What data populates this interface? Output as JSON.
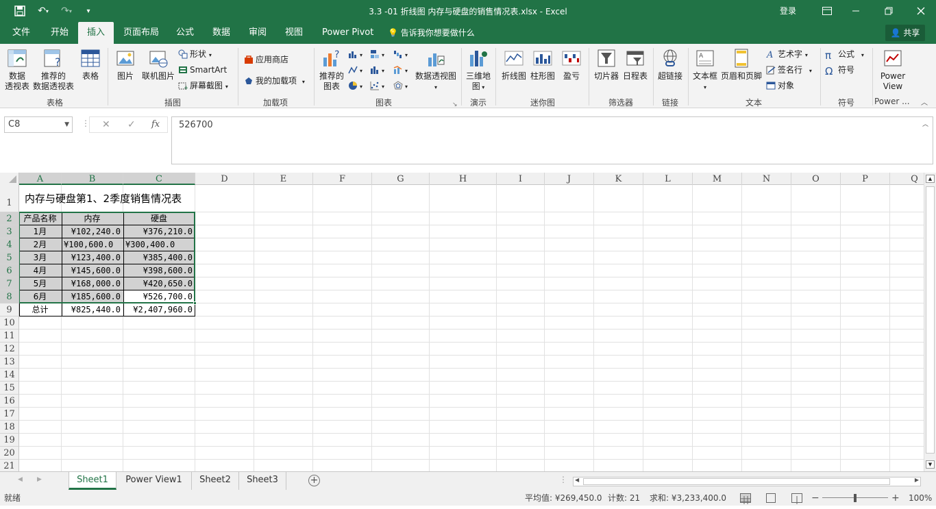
{
  "titlebar": {
    "doc_title": "3.3 -01 折线图 内存与硬盘的销售情况表.xlsx  -  Excel",
    "login": "登录"
  },
  "tabs": [
    {
      "label": "文件"
    },
    {
      "label": "开始"
    },
    {
      "label": "插入",
      "active": true
    },
    {
      "label": "页面布局"
    },
    {
      "label": "公式"
    },
    {
      "label": "数据"
    },
    {
      "label": "审阅"
    },
    {
      "label": "视图"
    },
    {
      "label": "Power Pivot"
    }
  ],
  "tellme": "告诉我你想要做什么",
  "share": "共享",
  "ribbon": {
    "groups": {
      "tables": "表格",
      "illustrations": "插图",
      "addins": "加载项",
      "charts": "图表",
      "tours": "演示",
      "sparklines": "迷你图",
      "filters": "筛选器",
      "links": "链接",
      "text": "文本",
      "symbols": "符号",
      "powerview": "Power ..."
    },
    "buttons": {
      "pivot1": "数据",
      "pivot2": "透视表",
      "recpivot1": "推荐的",
      "recpivot2": "数据透视表",
      "table": "表格",
      "picture": "图片",
      "online_picture": "联机图片",
      "shapes": "形状",
      "smartart": "SmartArt",
      "screenshot": "屏幕截图",
      "store": "应用商店",
      "my_addins": "我的加载项",
      "rec_chart1": "推荐的",
      "rec_chart2": "图表",
      "pivot_chart": "数据透视图",
      "map3d1": "三维地",
      "map3d2": "图",
      "line": "折线图",
      "column": "柱形图",
      "winloss": "盈亏",
      "slicer": "切片器",
      "timeline": "日程表",
      "hyperlink": "超链接",
      "textbox": "文本框",
      "header_footer": "页眉和页脚",
      "wordart": "艺术字",
      "signature": "签名行",
      "object": "对象",
      "equation": "公式",
      "symbol": "符号",
      "power_view1": "Power",
      "power_view2": "View"
    }
  },
  "formula_bar": {
    "name_box": "C8",
    "value": "526700"
  },
  "columns": [
    "A",
    "B",
    "C",
    "D",
    "E",
    "F",
    "G",
    "H",
    "I",
    "J",
    "K",
    "L",
    "M",
    "N",
    "O",
    "P",
    "Q"
  ],
  "rows": [
    "1",
    "2",
    "3",
    "4",
    "5",
    "6",
    "7",
    "8",
    "9",
    "10",
    "11",
    "12",
    "13",
    "14",
    "15",
    "16",
    "17",
    "18",
    "19",
    "20",
    "21"
  ],
  "sheet": {
    "title": "内存与硬盘第1、2季度销售情况表",
    "headers": [
      "产品名称",
      "内存",
      "硬盘"
    ],
    "data": [
      [
        "1月",
        "¥102,240.0",
        "¥376,210.0"
      ],
      [
        "2月",
        "¥100,600.0",
        "¥300,400.0"
      ],
      [
        "3月",
        "¥123,400.0",
        "¥385,400.0"
      ],
      [
        "4月",
        "¥145,600.0",
        "¥398,600.0"
      ],
      [
        "5月",
        "¥168,000.0",
        "¥420,650.0"
      ],
      [
        "6月",
        "¥185,600.0",
        "¥526,700.0"
      ]
    ],
    "total": [
      "总计",
      "¥825,440.0",
      "¥2,407,960.0"
    ]
  },
  "sheet_tabs": [
    {
      "label": "Sheet1",
      "active": true
    },
    {
      "label": "Power View1"
    },
    {
      "label": "Sheet2"
    },
    {
      "label": "Sheet3"
    }
  ],
  "status": {
    "ready": "就绪",
    "average": "平均值: ¥269,450.0",
    "count": "计数: 21",
    "sum": "求和: ¥3,233,400.0",
    "zoom": "100%"
  }
}
